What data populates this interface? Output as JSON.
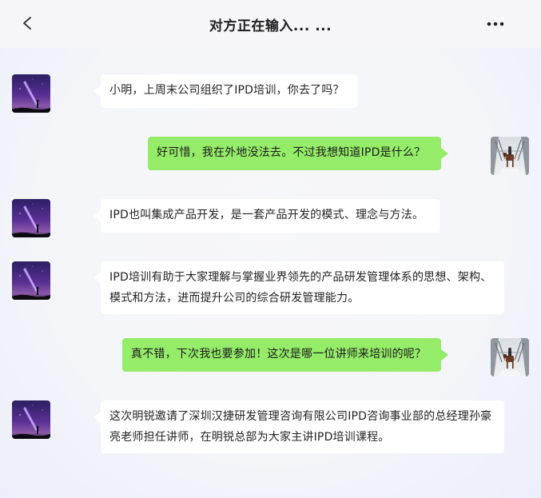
{
  "header": {
    "back_label": "<",
    "title": "对方正在输入... ...",
    "more_label": "•••"
  },
  "avatars": {
    "contact": "night-sky-laser-avatar",
    "self": "snowy-path-horse-avatar"
  },
  "messages": [
    {
      "side": "left",
      "text": "小明，上周末公司组织了IPD培训，你去了吗？"
    },
    {
      "side": "right",
      "text": "好可惜，我在外地没法去。不过我想知道IPD是什么？"
    },
    {
      "side": "left",
      "text": "IPD也叫集成产品开发，是一套产品开发的模式、理念与方法。"
    },
    {
      "side": "left",
      "text": "IPD培训有助于大家理解与掌握业界领先的产品研发管理体系的思想、架构、模式和方法，进而提升公司的综合研发管理能力。"
    },
    {
      "side": "right",
      "text": "真不错，下次我也要参加！这次是哪一位讲师来培训的呢？"
    },
    {
      "side": "left",
      "text": "这次明锐邀请了深圳汉捷研发管理咨询有限公司IPD咨询事业部的总经理孙豪亮老师担任讲师，在明锐总部为大家主讲IPD培训课程。"
    }
  ],
  "colors": {
    "incoming_bubble": "#ffffff",
    "outgoing_bubble": "#95ec69",
    "header_bg": "#f6f6f8"
  }
}
